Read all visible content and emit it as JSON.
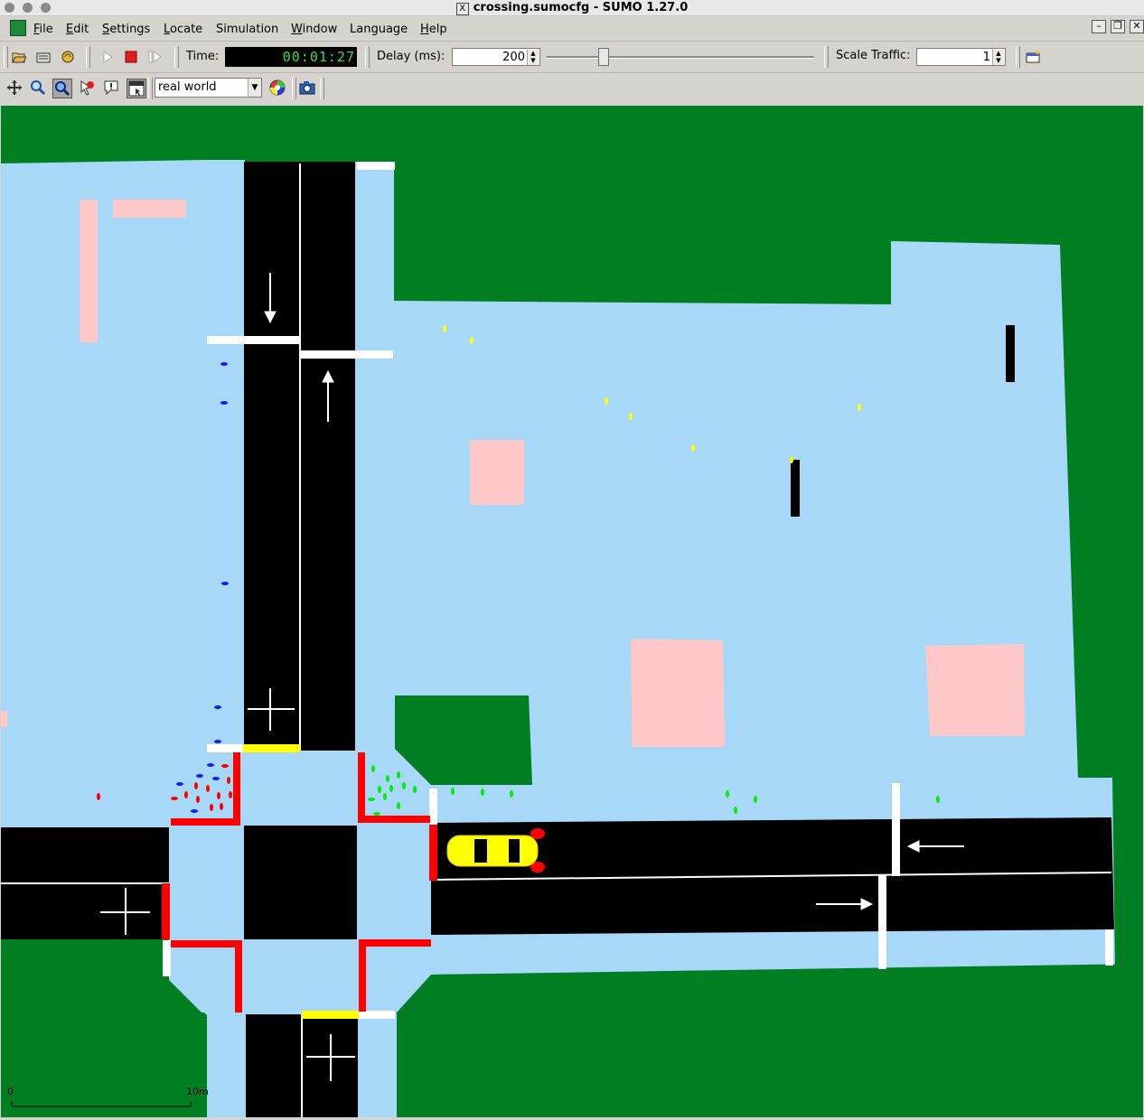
{
  "window": {
    "title": "crossing.sumocfg - SUMO 1.27.0"
  },
  "menu": {
    "items": [
      {
        "label": "File",
        "key": "F"
      },
      {
        "label": "Edit",
        "key": "E"
      },
      {
        "label": "Settings",
        "key": "S"
      },
      {
        "label": "Locate",
        "key": "L"
      },
      {
        "label": "Simulation",
        "key": ""
      },
      {
        "label": "Window",
        "key": "W"
      },
      {
        "label": "Language",
        "key": ""
      },
      {
        "label": "Help",
        "key": "H"
      }
    ]
  },
  "toolbar": {
    "time_label": "Time:",
    "time_value": "00:01:27",
    "delay_label": "Delay (ms):",
    "delay_value": "200",
    "delay_slider_fraction": 0.2,
    "scale_label": "Scale Traffic:",
    "scale_value": "1"
  },
  "view_toolbar": {
    "scheme": "real world",
    "icons": [
      "recenter-icon",
      "zoom-icon",
      "locate-icon",
      "select-icon",
      "additional-icon",
      "menu-icon"
    ]
  },
  "scale_bar": {
    "start": "0",
    "end": "10m"
  },
  "colors": {
    "grass": "#007f22",
    "sidewalk": "#a8d8f8",
    "road": "#000000",
    "building": "#ffc8c8",
    "crossing_red": "#ff0000",
    "stop_yellow": "#ffff00",
    "vehicle": "#ffff00"
  }
}
